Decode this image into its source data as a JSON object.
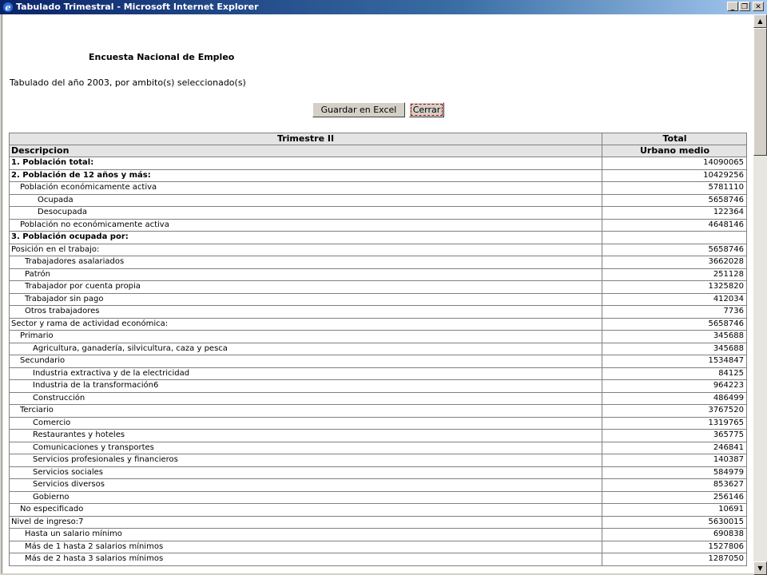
{
  "window": {
    "title": "Tabulado Trimestral - Microsoft Internet Explorer",
    "minimize": "_",
    "maximize": "❐",
    "close": "✕"
  },
  "page": {
    "survey_title": "Encuesta Nacional de Empleo",
    "subtitle": "Tabulado del año 2003, por ambito(s) seleccionado(s)",
    "buttons": {
      "excel": "Guardar en Excel",
      "close": "Cerrar"
    }
  },
  "table": {
    "header_top": {
      "period": "Trimestre II",
      "total": "Total"
    },
    "header_sub": {
      "description": "Descripcion",
      "area": "Urbano medio"
    },
    "rows": [
      {
        "label": "1. Población total:",
        "value": "14090065",
        "indent": 0,
        "bold": true
      },
      {
        "label": "2. Población de 12 años y más:",
        "value": "10429256",
        "indent": 0,
        "bold": true
      },
      {
        "label": "Población económicamente activa",
        "value": "5781110",
        "indent": 1,
        "bold": false
      },
      {
        "label": "Ocupada",
        "value": "5658746",
        "indent": 4,
        "bold": false
      },
      {
        "label": "Desocupada",
        "value": "122364",
        "indent": 4,
        "bold": false
      },
      {
        "label": "Población no económicamente activa",
        "value": "4648146",
        "indent": 1,
        "bold": false
      },
      {
        "label": "3. Población ocupada por:",
        "value": "",
        "indent": 0,
        "bold": true
      },
      {
        "label": "Posición en el trabajo:",
        "value": "5658746",
        "indent": 0,
        "bold": false
      },
      {
        "label": "Trabajadores asalariados",
        "value": "3662028",
        "indent": 2,
        "bold": false
      },
      {
        "label": "Patrón",
        "value": "251128",
        "indent": 2,
        "bold": false
      },
      {
        "label": "Trabajador por cuenta propia",
        "value": "1325820",
        "indent": 2,
        "bold": false
      },
      {
        "label": "Trabajador sin pago",
        "value": "412034",
        "indent": 2,
        "bold": false
      },
      {
        "label": "Otros trabajadores",
        "value": "7736",
        "indent": 2,
        "bold": false
      },
      {
        "label": "Sector y rama de actividad económica:",
        "value": "5658746",
        "indent": 0,
        "bold": false
      },
      {
        "label": "Primario",
        "value": "345688",
        "indent": 1,
        "bold": false
      },
      {
        "label": "Agricultura, ganadería, silvicultura, caza y pesca",
        "value": "345688",
        "indent": 3,
        "bold": false
      },
      {
        "label": "Secundario",
        "value": "1534847",
        "indent": 1,
        "bold": false
      },
      {
        "label": "Industria extractiva y de la electricidad",
        "value": "84125",
        "indent": 3,
        "bold": false
      },
      {
        "label": "Industria de la transformación6",
        "value": "964223",
        "indent": 3,
        "bold": false
      },
      {
        "label": "Construcción",
        "value": "486499",
        "indent": 3,
        "bold": false
      },
      {
        "label": "Terciario",
        "value": "3767520",
        "indent": 1,
        "bold": false
      },
      {
        "label": "Comercio",
        "value": "1319765",
        "indent": 3,
        "bold": false
      },
      {
        "label": "Restaurantes y hoteles",
        "value": "365775",
        "indent": 3,
        "bold": false
      },
      {
        "label": "Comunicaciones y transportes",
        "value": "246841",
        "indent": 3,
        "bold": false
      },
      {
        "label": "Servicios profesionales y financieros",
        "value": "140387",
        "indent": 3,
        "bold": false
      },
      {
        "label": "Servicios sociales",
        "value": "584979",
        "indent": 3,
        "bold": false
      },
      {
        "label": "Servicios diversos",
        "value": "853627",
        "indent": 3,
        "bold": false
      },
      {
        "label": "Gobierno",
        "value": "256146",
        "indent": 3,
        "bold": false
      },
      {
        "label": "No especificado",
        "value": "10691",
        "indent": 1,
        "bold": false
      },
      {
        "label": "Nivel de ingreso:7",
        "value": "5630015",
        "indent": 0,
        "bold": false
      },
      {
        "label": "Hasta un salario mínimo",
        "value": "690838",
        "indent": 2,
        "bold": false
      },
      {
        "label": "Más de 1 hasta 2 salarios mínimos",
        "value": "1527806",
        "indent": 2,
        "bold": false
      },
      {
        "label": "Más de 2 hasta 3 salarios mínimos",
        "value": "1287050",
        "indent": 2,
        "bold": false
      }
    ]
  },
  "scrollbar": {
    "up": "▲",
    "down": "▼"
  }
}
